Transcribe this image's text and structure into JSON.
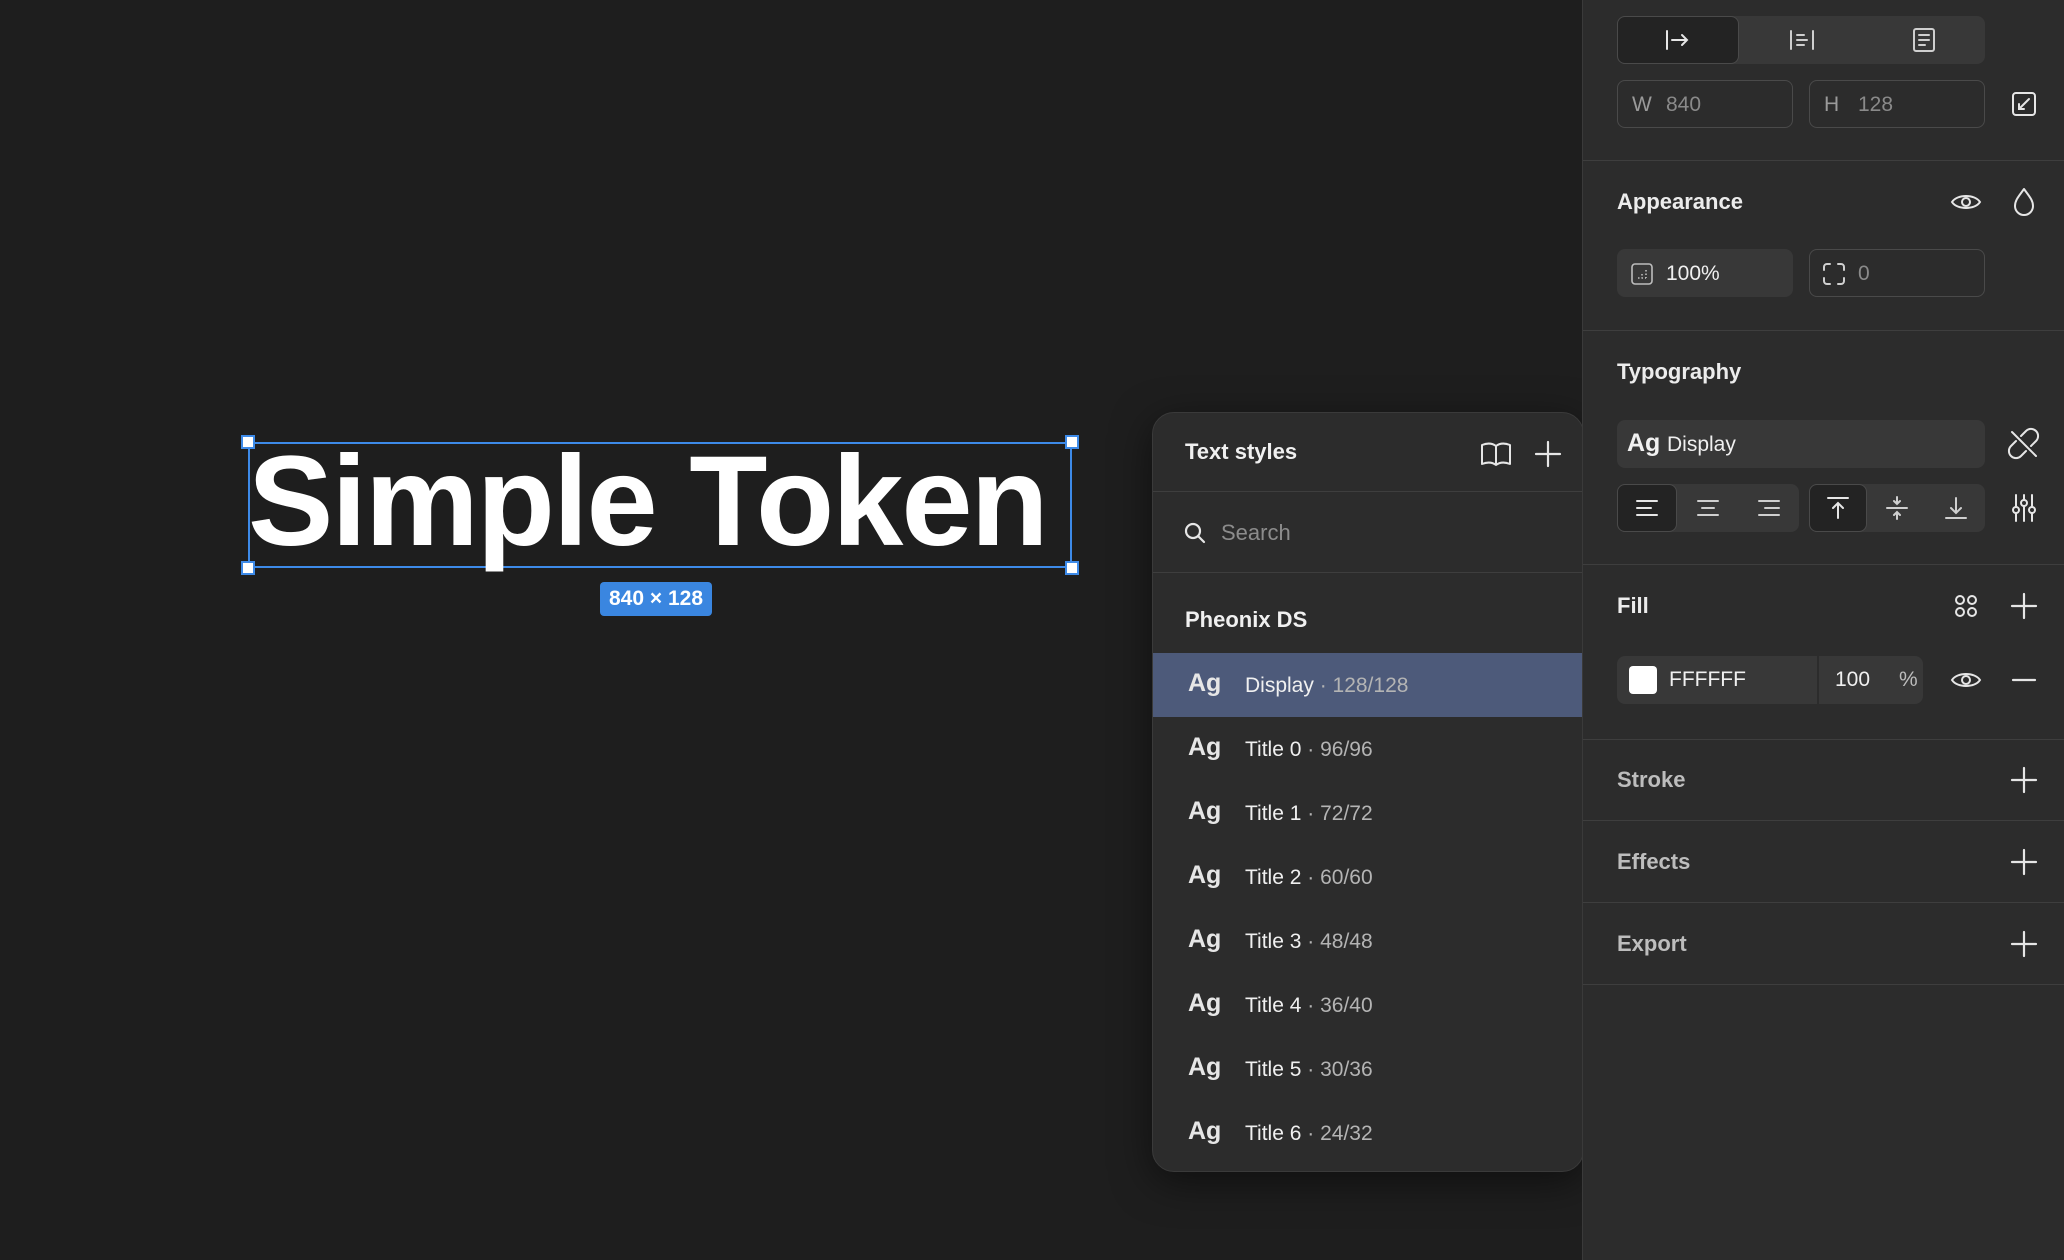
{
  "canvas": {
    "text_content": "Simple Token",
    "size_badge": "840 × 128"
  },
  "text_styles_popup": {
    "title": "Text styles",
    "search_placeholder": "Search",
    "group_label": "Pheonix DS",
    "styles": [
      {
        "ag": "Ag",
        "name": "Display",
        "meta": " · 128/128",
        "selected": true
      },
      {
        "ag": "Ag",
        "name": "Title 0",
        "meta": " · 96/96",
        "selected": false
      },
      {
        "ag": "Ag",
        "name": "Title 1",
        "meta": " · 72/72",
        "selected": false
      },
      {
        "ag": "Ag",
        "name": "Title 2",
        "meta": " · 60/60",
        "selected": false
      },
      {
        "ag": "Ag",
        "name": "Title 3",
        "meta": " · 48/48",
        "selected": false
      },
      {
        "ag": "Ag",
        "name": "Title 4",
        "meta": " · 36/40",
        "selected": false
      },
      {
        "ag": "Ag",
        "name": "Title 5",
        "meta": " · 30/36",
        "selected": false
      },
      {
        "ag": "Ag",
        "name": "Title 6",
        "meta": " · 24/32",
        "selected": false
      }
    ]
  },
  "inspector": {
    "size": {
      "w_label": "W",
      "w_value": "840",
      "h_label": "H",
      "h_value": "128"
    },
    "appearance": {
      "title": "Appearance",
      "opacity": "100%",
      "radius": "0"
    },
    "typography": {
      "title": "Typography",
      "style_ag": "Ag",
      "style_name": "Display"
    },
    "fill": {
      "title": "Fill",
      "hex": "FFFFFF",
      "opacity": "100",
      "percent": "%",
      "swatch_color": "#FFFFFF"
    },
    "stroke": {
      "title": "Stroke"
    },
    "effects": {
      "title": "Effects"
    },
    "export": {
      "title": "Export"
    }
  },
  "colors": {
    "selection": "#3D8AE8",
    "selected_row": "#4D5A7A",
    "panel": "#2C2C2C",
    "canvas": "#1E1E1E"
  }
}
